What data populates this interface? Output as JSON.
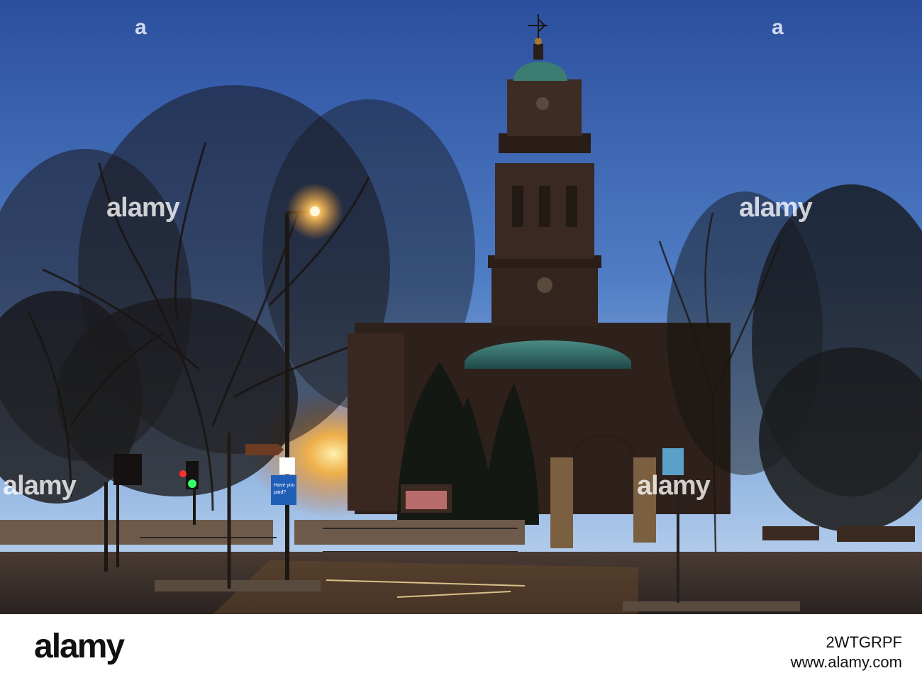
{
  "photo": {
    "subject": "church tower at dusk",
    "colors": {
      "sky_top": "#2f56a8",
      "sky_horizon": "#9fc0e8",
      "silhouette": "#120f0d",
      "stone": "#3b2a23",
      "copper_dome": "#2f6e6a",
      "street_light": "#ffb43a",
      "road": "#3a3030"
    },
    "signs": {
      "blue_sign_line1": "Have you",
      "blue_sign_line2": "paid?"
    }
  },
  "watermarks": {
    "center_left": "alamy",
    "center_right": "alamy",
    "bottom_left": "alamy",
    "bottom_right": "alamy",
    "top_small_a": "a",
    "top_small_b": "a"
  },
  "footer": {
    "brand": "alamy",
    "image_id": "2WTGRPF",
    "site": "www.alamy.com"
  }
}
